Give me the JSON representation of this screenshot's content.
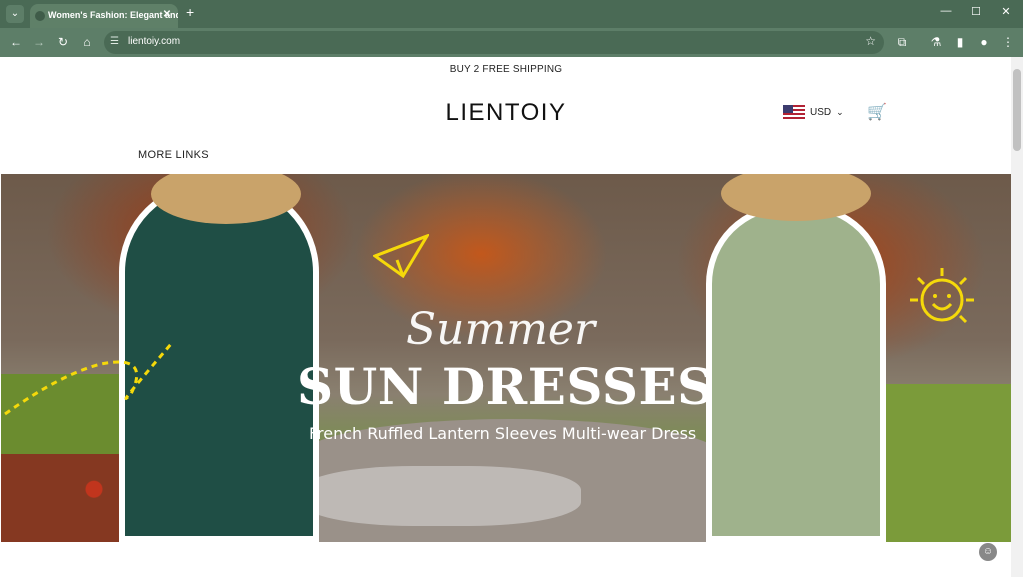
{
  "browser": {
    "tab_title": "Women's Fashion: Elegant and",
    "url": "lientoiy.com",
    "icons": [
      "tab-search-icon",
      "close-icon",
      "new-tab-icon",
      "minimize-icon",
      "maximize-icon",
      "close-window-icon",
      "back-icon",
      "forward-icon",
      "reload-icon",
      "home-icon",
      "site-settings-icon",
      "star-icon",
      "extensions-icon",
      "labs-icon",
      "sidepanel-icon",
      "profile-icon",
      "menu-icon"
    ]
  },
  "store": {
    "announcement": "BUY 2 FREE SHIPPING",
    "logo": "LIENTOIY",
    "currency": "USD",
    "nav_more": "MORE LINKS"
  },
  "hero": {
    "script_title": "Summer",
    "title": "SUN DRESSES",
    "subtitle": "French Ruffled Lantern Sleeves Multi-wear Dress"
  },
  "colors": {
    "chrome_dark": "#4a6a55",
    "chrome_mid": "#5d7e68",
    "left_dress": "#1f4e45",
    "right_dress": "#9fb28c"
  }
}
